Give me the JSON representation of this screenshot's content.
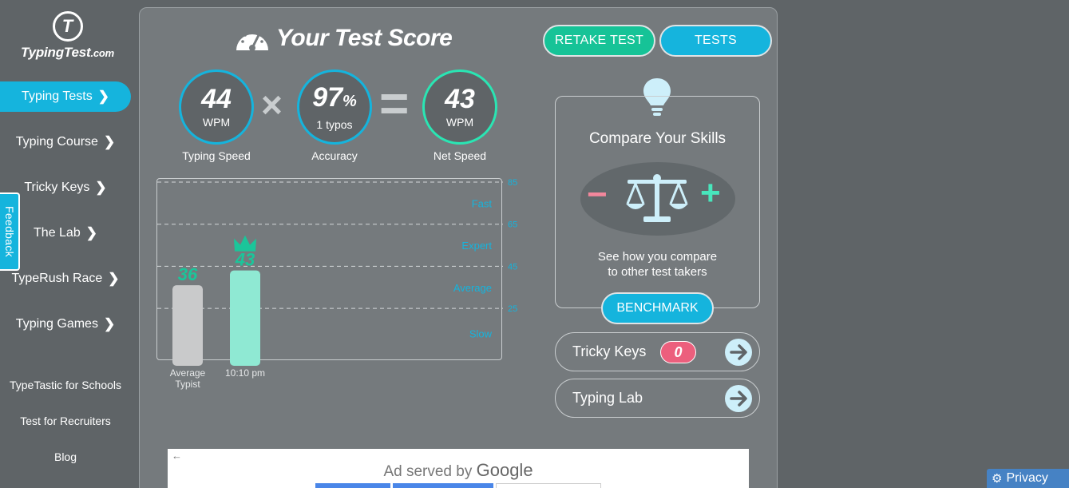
{
  "logo": {
    "name": "TypingTest",
    "suffix": ".com",
    "mark": "T"
  },
  "nav": {
    "items": [
      {
        "label": "Typing Tests",
        "active": true
      },
      {
        "label": "Typing Course"
      },
      {
        "label": "Tricky Keys"
      },
      {
        "label": "The Lab"
      },
      {
        "label": "TypeRush Race"
      },
      {
        "label": "Typing Games"
      }
    ],
    "chevron": "❯",
    "links": [
      "TypeTastic for Schools",
      "Test for Recruiters",
      "Blog"
    ]
  },
  "feedback": "Feedback",
  "header": {
    "title": "Your Test Score",
    "retake": "RETAKE TEST",
    "tests": "TESTS"
  },
  "stats": {
    "speed": {
      "value": "44",
      "unit": "WPM",
      "label": "Typing Speed"
    },
    "accuracy": {
      "value": "97",
      "suffix": "%",
      "typos": "1  typos",
      "label": "Accuracy"
    },
    "net": {
      "value": "43",
      "unit": "WPM",
      "label": "Net Speed"
    },
    "times": "×",
    "equals": "="
  },
  "chart_data": {
    "type": "bar",
    "categories": [
      "Average Typist",
      "10:10 pm"
    ],
    "values": [
      36,
      43
    ],
    "yticks": [
      25,
      45,
      65,
      85
    ],
    "ylim": [
      0,
      85
    ],
    "bands": [
      {
        "label": "Fast",
        "y": 75
      },
      {
        "label": "Expert",
        "y": 55
      },
      {
        "label": "Average",
        "y": 35
      },
      {
        "label": "Slow",
        "y": 13
      }
    ],
    "colors": [
      "#c9cacb",
      "#8fe9d3"
    ],
    "label_color": "#1bc59a",
    "crown_on": 1
  },
  "xlabels": {
    "average_1": "Average",
    "average_2": "Typist",
    "time": "10:10 pm"
  },
  "compare": {
    "title": "Compare Your Skills",
    "desc_1": "See how you compare",
    "desc_2": "to other test takers",
    "minus": "−",
    "plus": "+",
    "benchmark": "BENCHMARK"
  },
  "links": {
    "tricky": {
      "label": "Tricky Keys",
      "count": "0"
    },
    "lab": {
      "label": "Typing Lab"
    }
  },
  "ad": {
    "back": "←",
    "served_prefix": "Ad served by ",
    "served_brand": "Google"
  },
  "privacy": {
    "label": "Privacy",
    "icon": "gear-icon"
  }
}
